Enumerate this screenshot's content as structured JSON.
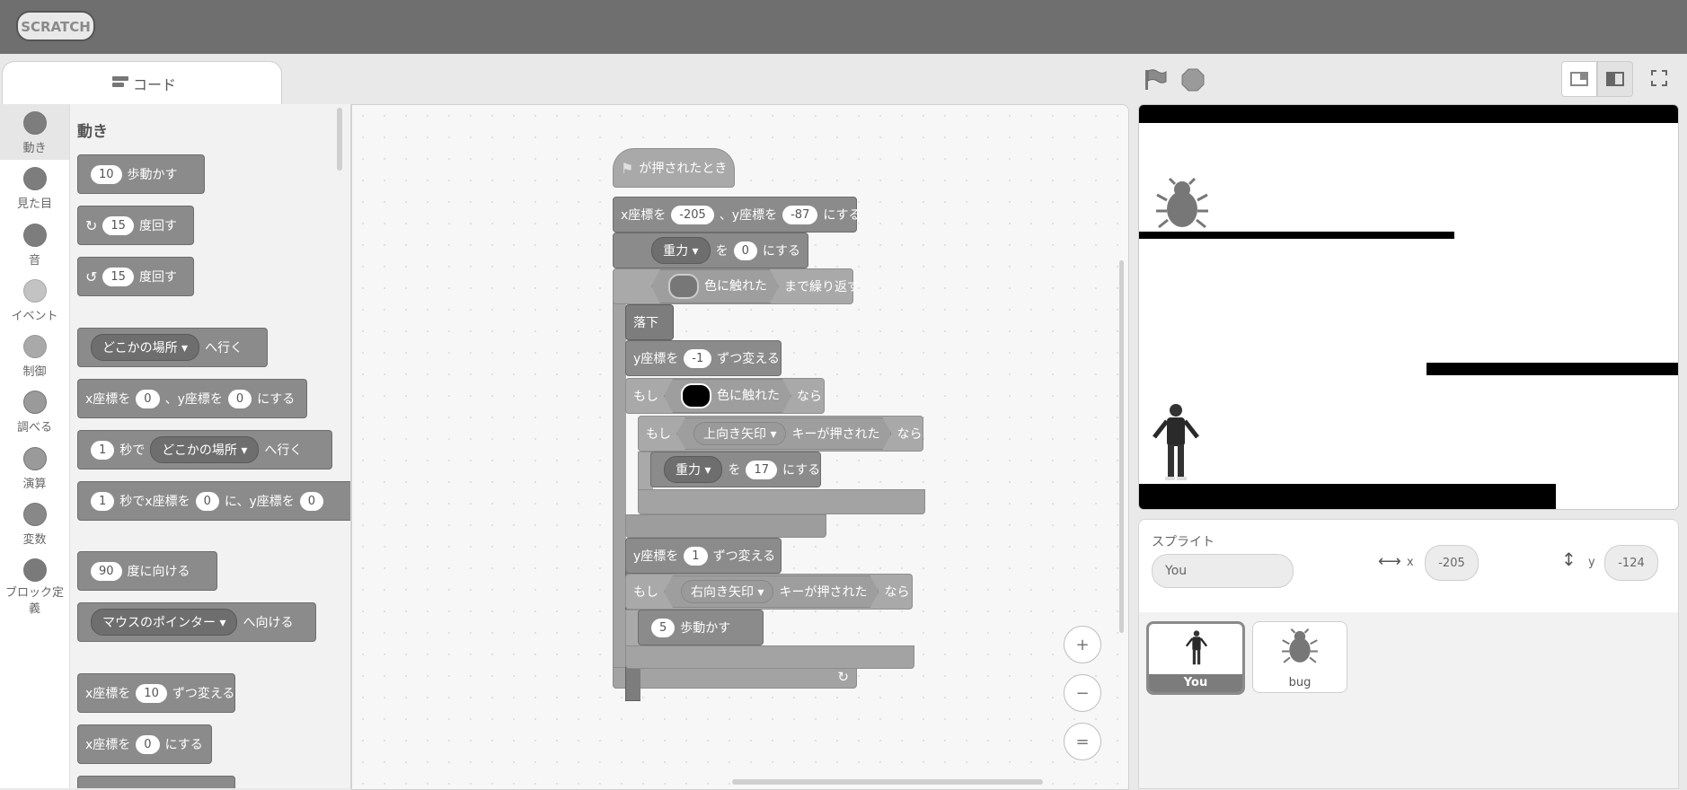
{
  "app": {
    "logo": "SCRATCH"
  },
  "tabs": {
    "code": "コード"
  },
  "categories": [
    {
      "label": "動き"
    },
    {
      "label": "見た目"
    },
    {
      "label": "音"
    },
    {
      "label": "イベント"
    },
    {
      "label": "制御"
    },
    {
      "label": "調べる"
    },
    {
      "label": "演算"
    },
    {
      "label": "変数"
    },
    {
      "label": "ブロック定義"
    }
  ],
  "palette": {
    "heading": "動き",
    "move": {
      "n": "10",
      "t": "歩動かす"
    },
    "turn_right": {
      "n": "15",
      "t": "度回す"
    },
    "turn_left": {
      "n": "15",
      "t": "度回す"
    },
    "goto": {
      "menu": "どこかの場所",
      "t": "へ行く"
    },
    "goto_xy": {
      "xl": "x座標を",
      "x": "0",
      "yl": "、y座標を",
      "y": "0",
      "t": "にする"
    },
    "glide": {
      "n": "1",
      "t1": "秒で",
      "menu": "どこかの場所",
      "t2": "へ行く"
    },
    "glide_xy": {
      "n": "1",
      "t1": "秒でx座標を",
      "x": "0",
      "t2": "に、y座標を",
      "y": "0"
    },
    "point_dir": {
      "n": "90",
      "t": "度に向ける"
    },
    "point_towards": {
      "menu": "マウスのポインター",
      "t": "へ向ける"
    },
    "change_x": {
      "l": "x座標を",
      "n": "10",
      "t": "ずつ変える"
    },
    "set_x": {
      "l": "x座標を",
      "n": "0",
      "t": "にする"
    }
  },
  "script": {
    "hat": "が押されたとき",
    "goto_xy": {
      "xl": "x座標を",
      "x": "-205",
      "yl": "、y座標を",
      "y": "-87",
      "t": "にする"
    },
    "set_var": {
      "var": "重力",
      "l": "を",
      "v": "0",
      "t": "にする"
    },
    "repeat_until": {
      "t1": "色に触れた",
      "t2": "まで繰り返す"
    },
    "fall": "落下",
    "change_y1": {
      "l": "y座標を",
      "n": "-1",
      "t": "ずつ変える"
    },
    "if1": {
      "l": "もし",
      "t1": "色に触れた",
      "t2": "なら"
    },
    "if2": {
      "l": "もし",
      "key": "上向き矢印",
      "t1": "キーが押された",
      "t2": "なら"
    },
    "set_var2": {
      "var": "重力",
      "l": "を",
      "v": "17",
      "t": "にする"
    },
    "change_y2": {
      "l": "y座標を",
      "n": "1",
      "t": "ずつ変える"
    },
    "if3": {
      "l": "もし",
      "key": "右向き矢印",
      "t1": "キーが押された",
      "t2": "なら"
    },
    "move": {
      "n": "5",
      "t": "歩動かす"
    },
    "loop_arrow": "↻"
  },
  "zoom": {
    "in": "+",
    "out": "−",
    "reset": "="
  },
  "sprite_info": {
    "label": "スプライト",
    "name": "You",
    "x_label": "x",
    "x": "-205",
    "y_label": "y",
    "y": "-124"
  },
  "sprites": [
    {
      "name": "You",
      "selected": true
    },
    {
      "name": "bug",
      "selected": false
    }
  ],
  "colors": {
    "topbar": "#6f6f6f",
    "block": "#8b8b8b",
    "stage_bar": "#000000"
  }
}
